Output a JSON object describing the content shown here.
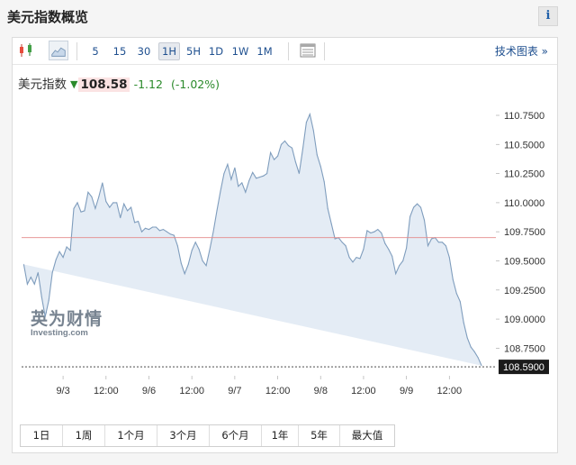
{
  "page": {
    "title": "美元指数概览",
    "info_label": "i"
  },
  "toolbar": {
    "intervals": [
      "5",
      "15",
      "30",
      "1H",
      "5H",
      "1D",
      "1W",
      "1M"
    ],
    "active_interval": "1H",
    "link_label": "技术图表 »"
  },
  "quote": {
    "name": "美元指数",
    "direction": "down",
    "price": "108.58",
    "change": "-1.12",
    "change_pct": "(-1.02%)"
  },
  "colors": {
    "line": "#7f9dbd",
    "fill": "#e4ecf5",
    "reference_line": "#e38a8a",
    "positive": "#2b8a2b",
    "link": "#1e4f8f"
  },
  "chart_data": {
    "type": "area",
    "title": "",
    "xlabel": "",
    "ylabel": "",
    "ylim": [
      108.53,
      110.84
    ],
    "y_ticks": [
      "110.7500",
      "110.5000",
      "110.2500",
      "110.0000",
      "109.7500",
      "109.5000",
      "109.2500",
      "109.0000",
      "108.7500"
    ],
    "x_tick_labels": [
      "9/3",
      "12:00",
      "9/6",
      "12:00",
      "9/7",
      "12:00",
      "9/8",
      "12:00",
      "9/9",
      "12:00"
    ],
    "x_tick_hours": [
      3,
      15,
      27,
      39,
      51,
      63,
      75,
      87,
      99,
      111
    ],
    "reference_value": 109.7,
    "last_value_label": "108.5900",
    "last_value": 108.59,
    "grid": false,
    "watermark": {
      "brand_cn": "英为财情",
      "brand_en": "Investing.com"
    },
    "x_hours": [
      -8,
      -7,
      -6,
      -5,
      -4,
      -3,
      -2,
      -1,
      0,
      1,
      2,
      3,
      4,
      5,
      6,
      7,
      8,
      9,
      10,
      11,
      12,
      13,
      14,
      15,
      16,
      17,
      18,
      19,
      20,
      21,
      22,
      23,
      24,
      25,
      26,
      27,
      28,
      29,
      30,
      31,
      32,
      33,
      34,
      35,
      36,
      37,
      38,
      39,
      40,
      41,
      42,
      43,
      44,
      45,
      46,
      47,
      48,
      49,
      50,
      51,
      52,
      53,
      54,
      55,
      56,
      57,
      58,
      59,
      60,
      61,
      62,
      63,
      64,
      65,
      66,
      67,
      68,
      69,
      70,
      71,
      72,
      73,
      74,
      75,
      76,
      77,
      78,
      79,
      80,
      81,
      82,
      83,
      84,
      85,
      86,
      87,
      88,
      89,
      90,
      91,
      92,
      93,
      94,
      95,
      96,
      97,
      98,
      99,
      100,
      101,
      102,
      103,
      104,
      105,
      106,
      107,
      108,
      109,
      110,
      111,
      112,
      113,
      114,
      115,
      116,
      117,
      118,
      119,
      120,
      121,
      122,
      123
    ],
    "values": [
      109.47,
      109.3,
      109.36,
      109.3,
      109.4,
      109.19,
      109.02,
      109.16,
      109.4,
      109.51,
      109.58,
      109.53,
      109.62,
      109.59,
      109.95,
      110.0,
      109.92,
      109.93,
      110.09,
      110.05,
      109.95,
      110.05,
      110.17,
      110.01,
      109.96,
      110.0,
      110.0,
      109.87,
      109.99,
      109.93,
      109.96,
      109.83,
      109.84,
      109.75,
      109.78,
      109.77,
      109.79,
      109.79,
      109.76,
      109.77,
      109.75,
      109.73,
      109.72,
      109.63,
      109.48,
      109.39,
      109.47,
      109.59,
      109.66,
      109.6,
      109.5,
      109.46,
      109.6,
      109.75,
      109.93,
      110.1,
      110.25,
      110.33,
      110.2,
      110.3,
      110.14,
      110.17,
      110.09,
      110.19,
      110.26,
      110.21,
      110.22,
      110.23,
      110.25,
      110.43,
      110.37,
      110.4,
      110.5,
      110.53,
      110.49,
      110.47,
      110.35,
      110.25,
      110.46,
      110.69,
      110.76,
      110.62,
      110.41,
      110.31,
      110.18,
      109.95,
      109.82,
      109.69,
      109.7,
      109.66,
      109.63,
      109.53,
      109.49,
      109.53,
      109.52,
      109.6,
      109.76,
      109.74,
      109.75,
      109.77,
      109.74,
      109.65,
      109.6,
      109.54,
      109.39,
      109.46,
      109.5,
      109.61,
      109.88,
      109.96,
      109.99,
      109.96,
      109.85,
      109.63,
      109.69,
      109.7,
      109.66,
      109.66,
      109.63,
      109.53,
      109.34,
      109.22,
      109.15,
      108.97,
      108.84,
      108.76,
      108.72,
      108.67,
      108.6
    ]
  },
  "ranges": [
    "1日",
    "1周",
    "1个月",
    "3个月",
    "6个月",
    "1年",
    "5年",
    "最大值"
  ]
}
